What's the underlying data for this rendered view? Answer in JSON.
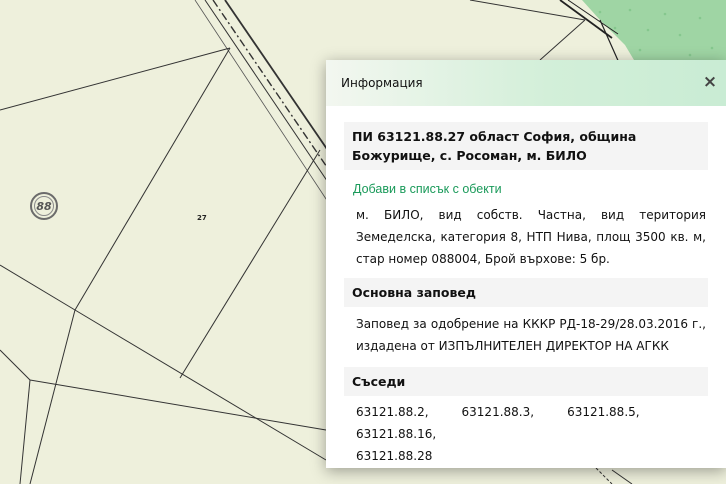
{
  "map": {
    "parcel_number": "27",
    "block_number": "88"
  },
  "popup": {
    "title": "Информация",
    "close_label": "×",
    "parcel_heading": "ПИ 63121.88.27 област София, община Божурище, с. Росоман, м. БИЛО",
    "add_link": "Добави в списък с обекти",
    "description": "м. БИЛО, вид собств. Частна, вид територия Земеделска, категория 8, НТП Нива, площ 3500 кв. м, стар номер 088004, Брой върхове: 5 бр.",
    "order_heading": "Основна заповед",
    "order_text": "Заповед за одобрение на КККР РД-18-29/28.03.2016 г., издадена от ИЗПЪЛНИТЕЛЕН ДИРЕКТОР НА АГКК",
    "neighbours_heading": "Съседи",
    "neighbours": [
      "63121.88.2,",
      "63121.88.3,",
      "63121.88.5,",
      "63121.88.16,",
      "63121.88.28"
    ]
  },
  "colors": {
    "map_background": "#eef0dc",
    "forest": "#9fd5a4",
    "link": "#1a9a5a",
    "header_green": "#c9ecd4"
  }
}
